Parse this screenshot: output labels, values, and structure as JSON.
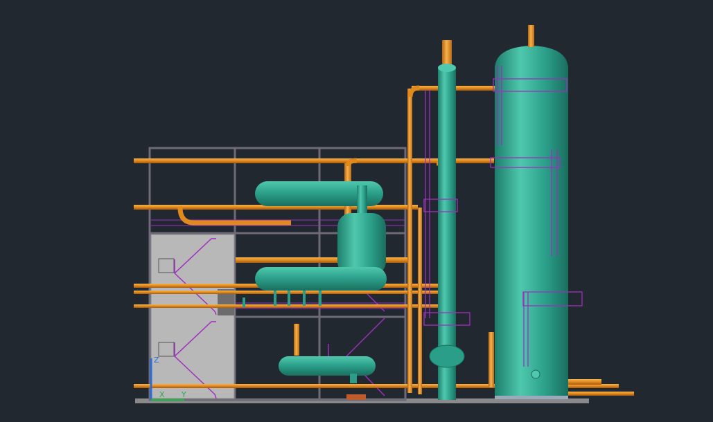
{
  "app": {
    "title": ""
  },
  "colors": {
    "background": "#212830",
    "pipe": "#e08a1e",
    "pipe_light": "#f5b24d",
    "vessel": "#2a9e88",
    "vessel_light": "#4fc8ad",
    "frame": "#6e6a78",
    "wall": "#b8b8b8",
    "stairs": "#a02ec0",
    "ucs_x": "#2ea84a",
    "ucs_y": "#2b6fd6"
  },
  "ucs": {
    "x_label": "X",
    "y_label": "Y",
    "z_label": "Z"
  }
}
